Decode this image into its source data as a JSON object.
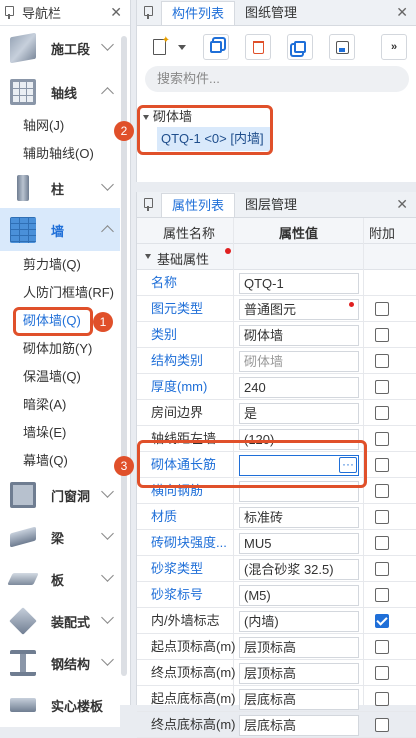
{
  "nav": {
    "title": "导航栏",
    "categories": [
      {
        "label": "施工段"
      },
      {
        "label": "轴线"
      },
      {
        "label": "柱"
      },
      {
        "label": "墙"
      },
      {
        "label": "门窗洞"
      },
      {
        "label": "梁"
      },
      {
        "label": "板"
      },
      {
        "label": "装配式"
      },
      {
        "label": "钢结构"
      },
      {
        "label": "实心楼板"
      }
    ],
    "axis_items": [
      "轴网(J)",
      "辅助轴线(O)"
    ],
    "wall_items": [
      "剪力墙(Q)",
      "人防门框墙(RF)",
      "砌体墙(Q)",
      "砌体加筋(Y)",
      "保温墙(Q)",
      "暗梁(A)",
      "墙垛(E)",
      "幕墙(Q)"
    ]
  },
  "components": {
    "tab_active": "构件列表",
    "tab_other": "图纸管理",
    "search_placeholder": "搜索构件...",
    "tree_root": "砌体墙",
    "tree_item": "QTQ-1 <0> [内墙]"
  },
  "properties": {
    "tab_active": "属性列表",
    "tab_other": "图层管理",
    "col_name": "属性名称",
    "col_value": "属性值",
    "col_extra": "附加",
    "group": "基础属性",
    "rows": [
      {
        "name": "名称",
        "value": "QTQ-1",
        "blue": true,
        "check": null
      },
      {
        "name": "图元类型",
        "value": "普通图元",
        "blue": true,
        "check": false
      },
      {
        "name": "类别",
        "value": "砌体墙",
        "blue": true,
        "check": false
      },
      {
        "name": "结构类别",
        "value": "砌体墙",
        "blue": true,
        "check": false,
        "gray": true
      },
      {
        "name": "厚度(mm)",
        "value": "240",
        "blue": true,
        "check": false
      },
      {
        "name": "房间边界",
        "value": "是",
        "blue": false,
        "check": false
      },
      {
        "name": "轴线距左墙...",
        "value": "(120)",
        "blue": false,
        "check": false
      },
      {
        "name": "砌体通长筋",
        "value": "",
        "blue": true,
        "check": false
      },
      {
        "name": "横向钢筋",
        "value": "",
        "blue": true,
        "check": false
      },
      {
        "name": "材质",
        "value": "标准砖",
        "blue": true,
        "check": false
      },
      {
        "name": "砖砌块强度...",
        "value": "MU5",
        "blue": true,
        "check": false
      },
      {
        "name": "砂浆类型",
        "value": "(混合砂浆  32.5)",
        "blue": true,
        "check": false
      },
      {
        "name": "砂浆标号",
        "value": "(M5)",
        "blue": true,
        "check": false
      },
      {
        "name": "内/外墙标志",
        "value": "(内墙)",
        "blue": false,
        "check": true
      },
      {
        "name": "起点顶标高(m)",
        "value": "层顶标高",
        "blue": false,
        "check": false
      },
      {
        "name": "终点顶标高(m)",
        "value": "层顶标高",
        "blue": false,
        "check": false
      },
      {
        "name": "起点底标高(m)",
        "value": "层底标高",
        "blue": false,
        "check": false
      },
      {
        "name": "终点底标高(m)",
        "value": "层底标高",
        "blue": false,
        "check": false
      }
    ],
    "ellipsis": "···"
  },
  "badges": [
    "1",
    "2",
    "3"
  ],
  "colors": {
    "accent": "#1f6fd8",
    "highlight": "#e0502a",
    "selection": "#d9e9fb"
  }
}
